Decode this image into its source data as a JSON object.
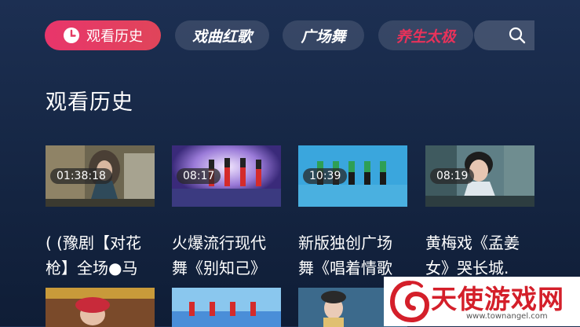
{
  "nav": {
    "history_label": "观看历史",
    "opera_label": "戏曲红歌",
    "square_label": "广场舞",
    "taichi_label": "养生太极"
  },
  "section": {
    "title": "观看历史"
  },
  "history": [
    {
      "duration": "01:38:18",
      "title": "( (豫剧【对花枪】全场●马"
    },
    {
      "duration": "08:17",
      "title": "火爆流行现代舞《别知己》"
    },
    {
      "duration": "10:39",
      "title": "新版独创广场舞《唱着情歌"
    },
    {
      "duration": "08:19",
      "title": "黄梅戏《孟姜女》哭长城."
    }
  ],
  "watermark": {
    "title": "天使游戏网",
    "url": "www.townangel.com"
  },
  "colors": {
    "accent": "#e8356b",
    "taichi": "#e8325a",
    "background": "#172a49"
  }
}
